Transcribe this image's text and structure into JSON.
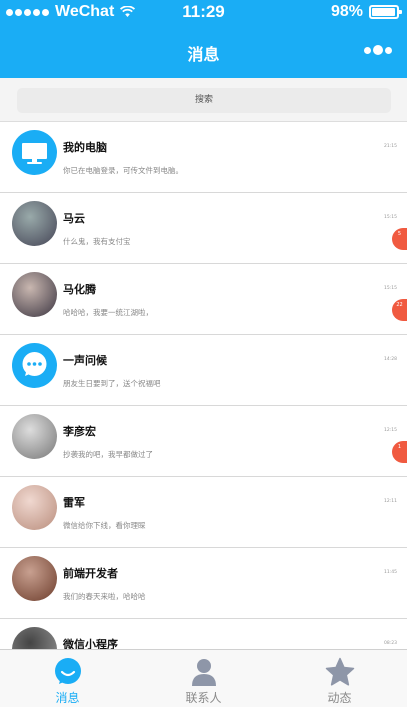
{
  "status_bar": {
    "carrier": "WeChat",
    "time": "11:29",
    "battery_text": "98%",
    "battery_level": 0.98
  },
  "nav": {
    "title": "消息"
  },
  "search": {
    "placeholder": "搜索"
  },
  "colors": {
    "brand": "#1aadf5",
    "badge": "#f05a40"
  },
  "conversations": [
    {
      "name": "我的电脑",
      "message": "你已在电脑登录，可传文件到电脑。",
      "time": "21:15",
      "avatar": "computer-icon"
    },
    {
      "name": "马云",
      "message": "什么鬼，我有支付宝",
      "time": "15:15",
      "badge": "5",
      "avatar": "photo-avatar"
    },
    {
      "name": "马化腾",
      "message": "哈哈哈，我要一统江湖啦，",
      "time": "15:15",
      "badge": "22",
      "avatar": "photo-avatar"
    },
    {
      "name": "一声问候",
      "message": "朋友生日要到了，送个祝福吧",
      "time": "14:28",
      "avatar": "chat-bubble-icon"
    },
    {
      "name": "李彦宏",
      "message": "抄袭我的吧，我早都做过了",
      "time": "12:15",
      "badge": "1",
      "avatar": "photo-avatar"
    },
    {
      "name": "雷军",
      "message": "微信给你下线，看你理睬",
      "time": "12:11",
      "avatar": "photo-avatar"
    },
    {
      "name": "前端开发者",
      "message": "我们的春天来啦，哈哈哈",
      "time": "11:45",
      "avatar": "photo-avatar"
    },
    {
      "name": "微信小程序",
      "message": "",
      "time": "08:23",
      "avatar": "photo-avatar"
    }
  ],
  "tabs": [
    {
      "label": "消息",
      "icon": "chat-bubble-icon",
      "active": true
    },
    {
      "label": "联系人",
      "icon": "person-icon",
      "active": false
    },
    {
      "label": "动态",
      "icon": "star-icon",
      "active": false
    }
  ]
}
